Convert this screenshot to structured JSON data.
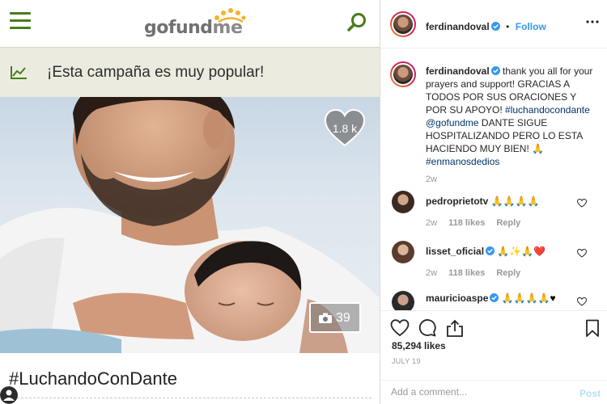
{
  "gofundme": {
    "logo": {
      "go": "go",
      "fund": "fund",
      "me": "me"
    },
    "popular_text": "¡Esta campaña es muy popular!",
    "heart_count": "1.8 k",
    "photo_count": "39",
    "campaign_title": "#LuchandoConDante"
  },
  "instagram": {
    "header": {
      "username": "ferdinandoval",
      "separator": "•",
      "follow_label": "Follow"
    },
    "caption": {
      "username": "ferdinandoval",
      "text_a": "thank you all for your prayers and support! GRACIAS A TODOS POR SUS ORACIONES Y POR SU APOYO!",
      "tag1": "#luchandocondante",
      "mention": "@gofundme",
      "text_b": "DANTE SIGUE HOSPITALIZANDO PERO LO ESTA HACIENDO MUY BIEN! 🙏",
      "tag2": "#enmanosdedios",
      "age": "2w"
    },
    "comments": [
      {
        "username": "pedroprietotv",
        "text": "🙏🙏🙏🙏",
        "age": "2w",
        "likes": "118 likes",
        "reply": "Reply"
      },
      {
        "username": "lisset_oficial",
        "text": "🙏✨🙏❤️",
        "age": "2w",
        "likes": "118 likes",
        "reply": "Reply"
      },
      {
        "username": "mauricioaspe",
        "text": "🙏🙏🙏🙏♥"
      }
    ],
    "likes": "85,294 likes",
    "date": "JULY 19",
    "add_comment_placeholder": "Add a comment...",
    "post_label": "Post"
  },
  "colors": {
    "gofundme_green": "#4a7b1c",
    "popular_bg": "#ebecdf",
    "ig_link": "#3897f0",
    "ig_tag": "#003569"
  },
  "icons": [
    "hamburger-icon",
    "search-icon",
    "trend-icon",
    "heart-icon",
    "camera-icon",
    "user-icon",
    "verified-icon",
    "more-icon",
    "like-icon",
    "comment-icon",
    "share-icon",
    "save-icon"
  ]
}
